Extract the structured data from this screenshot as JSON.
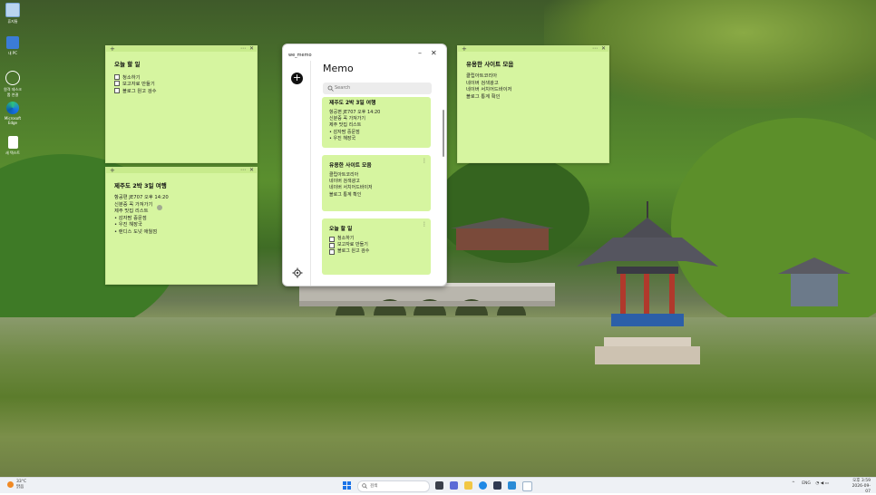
{
  "desktop": {
    "icons": [
      {
        "label": "휴지통",
        "icon": "recycle-bin-icon"
      },
      {
        "label": "내 PC",
        "icon": "computer-icon"
      },
      {
        "label": "원격 데스크톱 연결",
        "icon": "remote-desktop-icon"
      },
      {
        "label": "Microsoft Edge",
        "icon": "edge-browser-icon"
      },
      {
        "label": "새 텍스트",
        "icon": "document-icon"
      }
    ]
  },
  "sticky_notes": {
    "todo": {
      "title": "오늘 할 일",
      "items": [
        "청소하기",
        "보고자료 만들기",
        "블로그 원고 검수"
      ]
    },
    "jeju": {
      "title": "제주도 2박 3일 여행",
      "lines": [
        "항공편 JE707 오후 14:20",
        "신분증 꼭 가져가기",
        "제주 맛집 리스트",
        "• 감자팜 중문점",
        "• 우진 해장국",
        "• 랜디스 도넛 애월점"
      ]
    },
    "sites": {
      "title": "유용한 사이트 모음",
      "lines": [
        "클립아트코리아",
        "네이버 검색광고",
        "네이버 서치어드바이저",
        "블로그 통계 확인"
      ]
    }
  },
  "memo_app": {
    "window_title": "we_memo",
    "heading": "Memo",
    "search_placeholder": "Search",
    "add_label": "+",
    "cards": [
      {
        "title": "제주도 2박 3일 여행",
        "lines": [
          "항공편 JE707 오후 14:20",
          "신분증 꼭 가져가기",
          "제주 맛집 리스트",
          "• 감자팜 중문점",
          "• 우진 해장국"
        ]
      },
      {
        "title": "유용한 사이트 모음",
        "lines": [
          "클립아트코리아",
          "네이버 검색광고",
          "네이버 서치어드바이저",
          "블로그 통계 확인"
        ]
      },
      {
        "title": "오늘 할 일",
        "items": [
          "청소하기",
          "보고자료 만들기",
          "블로그 원고 검수"
        ]
      }
    ]
  },
  "taskbar": {
    "weather_temp": "33°C",
    "weather_desc": "맑음",
    "search_placeholder": "검색",
    "tray_lang": "ENG",
    "clock_time": "오후 3:59",
    "clock_date": "2026-09-07"
  },
  "colors": {
    "note_bg": "#d6f5a0",
    "note_bar": "#c8eb8c",
    "taskbar_bg": "#eef1f5"
  }
}
